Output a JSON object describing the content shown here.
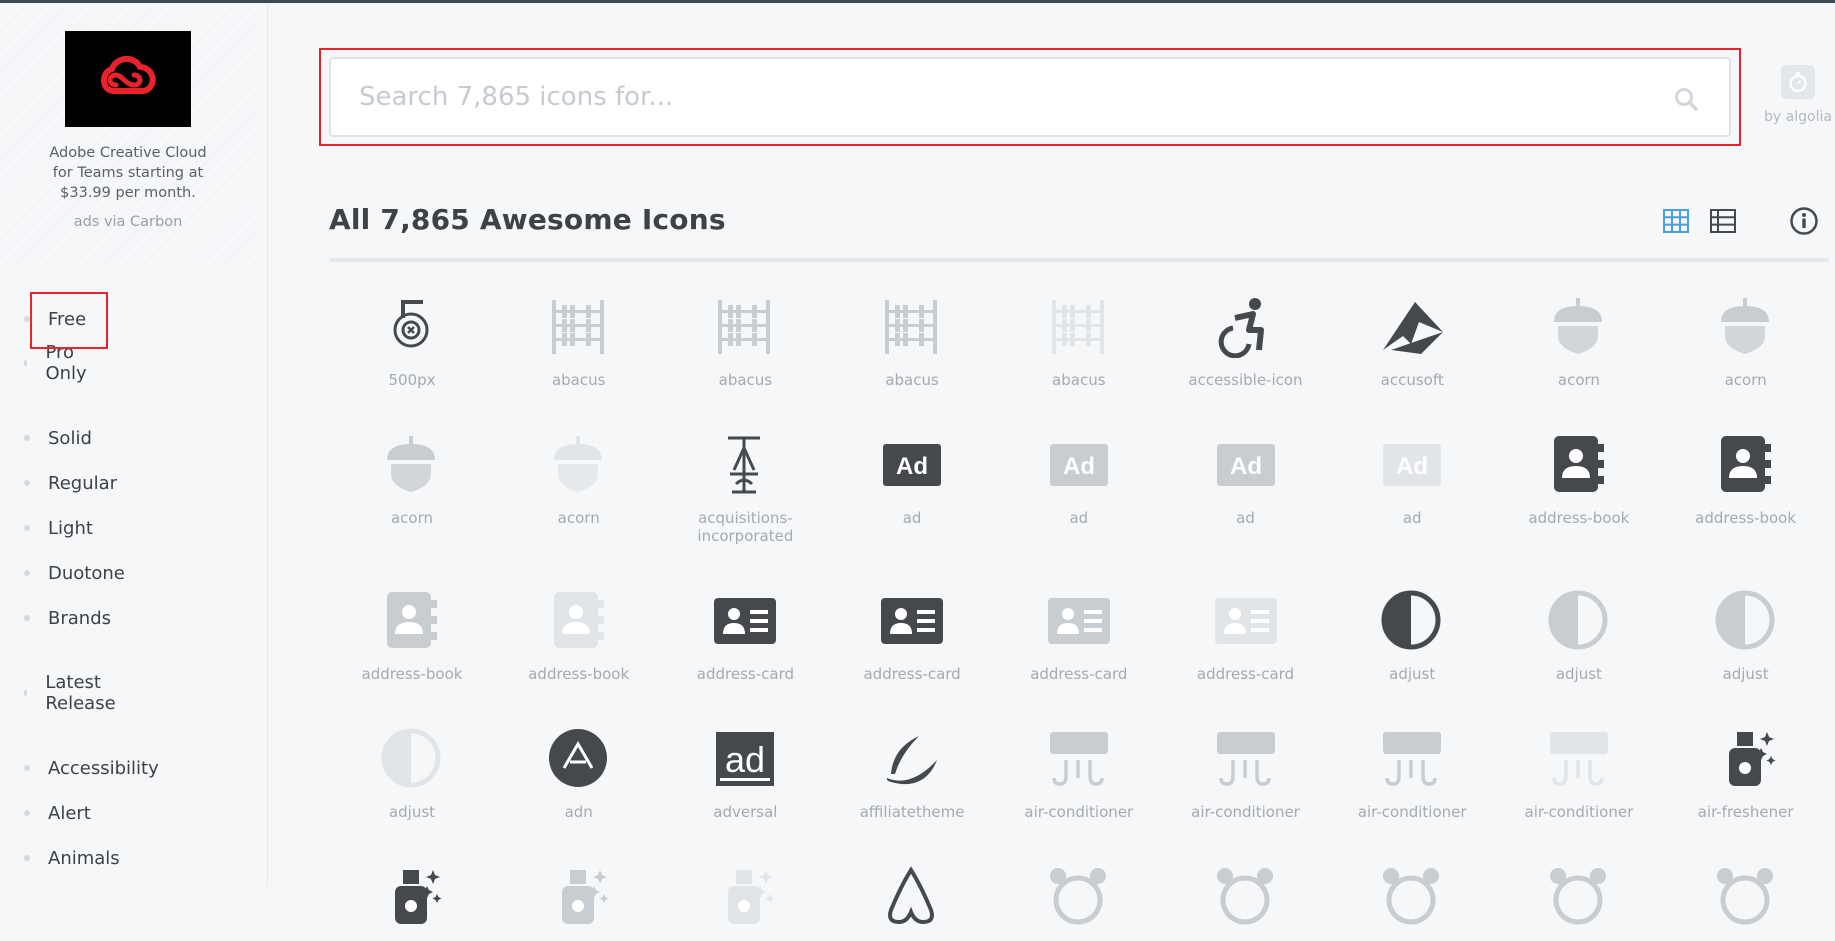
{
  "ad": {
    "text": "Adobe Creative Cloud for Teams starting at $33.99 per month.",
    "via": "ads via Carbon"
  },
  "nav": {
    "license": [
      "Free",
      "Pro Only"
    ],
    "styles": [
      "Solid",
      "Regular",
      "Light",
      "Duotone",
      "Brands"
    ],
    "latest": "Latest Release",
    "categories": [
      "Accessibility",
      "Alert",
      "Animals"
    ]
  },
  "search": {
    "placeholder": "Search 7,865 icons for...",
    "by": "by algolia"
  },
  "main": {
    "title": "All 7,865 Awesome Icons"
  },
  "colors": {
    "dark": "#45494e",
    "mid": "#c8cdd2",
    "light": "#e2e5e8",
    "highlight": "#e8232c",
    "accent": "#4a9fe3"
  },
  "icons": [
    {
      "name": "500px",
      "icon": "500px-icon",
      "tone": "dark"
    },
    {
      "name": "abacus",
      "icon": "abacus-icon",
      "tone": "mid"
    },
    {
      "name": "abacus",
      "icon": "abacus-icon",
      "tone": "mid"
    },
    {
      "name": "abacus",
      "icon": "abacus-icon",
      "tone": "mid"
    },
    {
      "name": "abacus",
      "icon": "abacus-icon",
      "tone": "light"
    },
    {
      "name": "accessible-icon",
      "icon": "accessible-icon",
      "tone": "dark"
    },
    {
      "name": "accusoft",
      "icon": "accusoft-icon",
      "tone": "dark"
    },
    {
      "name": "acorn",
      "icon": "acorn-icon",
      "tone": "mid"
    },
    {
      "name": "acorn",
      "icon": "acorn-icon",
      "tone": "mid"
    },
    {
      "name": "acorn",
      "icon": "acorn-icon",
      "tone": "mid"
    },
    {
      "name": "acorn",
      "icon": "acorn-icon",
      "tone": "light"
    },
    {
      "name": "acquisitions-incorporated",
      "icon": "acquisitions-incorporated-icon",
      "tone": "dark"
    },
    {
      "name": "ad",
      "icon": "ad-icon",
      "tone": "dark"
    },
    {
      "name": "ad",
      "icon": "ad-icon",
      "tone": "mid"
    },
    {
      "name": "ad",
      "icon": "ad-icon",
      "tone": "mid"
    },
    {
      "name": "ad",
      "icon": "ad-icon",
      "tone": "light"
    },
    {
      "name": "address-book",
      "icon": "address-book-icon",
      "tone": "dark"
    },
    {
      "name": "address-book",
      "icon": "address-book-icon",
      "tone": "dark"
    },
    {
      "name": "address-book",
      "icon": "address-book-icon",
      "tone": "mid"
    },
    {
      "name": "address-book",
      "icon": "address-book-icon",
      "tone": "light"
    },
    {
      "name": "address-card",
      "icon": "address-card-icon",
      "tone": "dark"
    },
    {
      "name": "address-card",
      "icon": "address-card-icon",
      "tone": "dark"
    },
    {
      "name": "address-card",
      "icon": "address-card-icon",
      "tone": "mid"
    },
    {
      "name": "address-card",
      "icon": "address-card-icon",
      "tone": "light"
    },
    {
      "name": "adjust",
      "icon": "adjust-icon",
      "tone": "dark"
    },
    {
      "name": "adjust",
      "icon": "adjust-icon",
      "tone": "mid"
    },
    {
      "name": "adjust",
      "icon": "adjust-icon",
      "tone": "mid"
    },
    {
      "name": "adjust",
      "icon": "adjust-icon",
      "tone": "light"
    },
    {
      "name": "adn",
      "icon": "adn-icon",
      "tone": "dark"
    },
    {
      "name": "adversal",
      "icon": "adversal-icon",
      "tone": "dark"
    },
    {
      "name": "affiliatetheme",
      "icon": "affiliatetheme-icon",
      "tone": "dark"
    },
    {
      "name": "air-conditioner",
      "icon": "air-conditioner-icon",
      "tone": "mid"
    },
    {
      "name": "air-conditioner",
      "icon": "air-conditioner-icon",
      "tone": "mid"
    },
    {
      "name": "air-conditioner",
      "icon": "air-conditioner-icon",
      "tone": "mid"
    },
    {
      "name": "air-conditioner",
      "icon": "air-conditioner-icon",
      "tone": "light"
    },
    {
      "name": "air-freshener",
      "icon": "air-freshener-icon",
      "tone": "dark"
    },
    {
      "name": "",
      "icon": "air-freshener-icon",
      "tone": "dark"
    },
    {
      "name": "",
      "icon": "air-freshener-icon",
      "tone": "mid"
    },
    {
      "name": "",
      "icon": "air-freshener-icon",
      "tone": "light"
    },
    {
      "name": "",
      "icon": "airbnb-icon",
      "tone": "dark"
    },
    {
      "name": "",
      "icon": "alarm-clock-icon",
      "tone": "mid"
    },
    {
      "name": "",
      "icon": "alarm-clock-icon",
      "tone": "mid"
    },
    {
      "name": "",
      "icon": "alarm-clock-icon",
      "tone": "mid"
    },
    {
      "name": "",
      "icon": "alarm-clock-icon",
      "tone": "mid"
    },
    {
      "name": "",
      "icon": "alarm-clock-icon",
      "tone": "mid"
    }
  ]
}
